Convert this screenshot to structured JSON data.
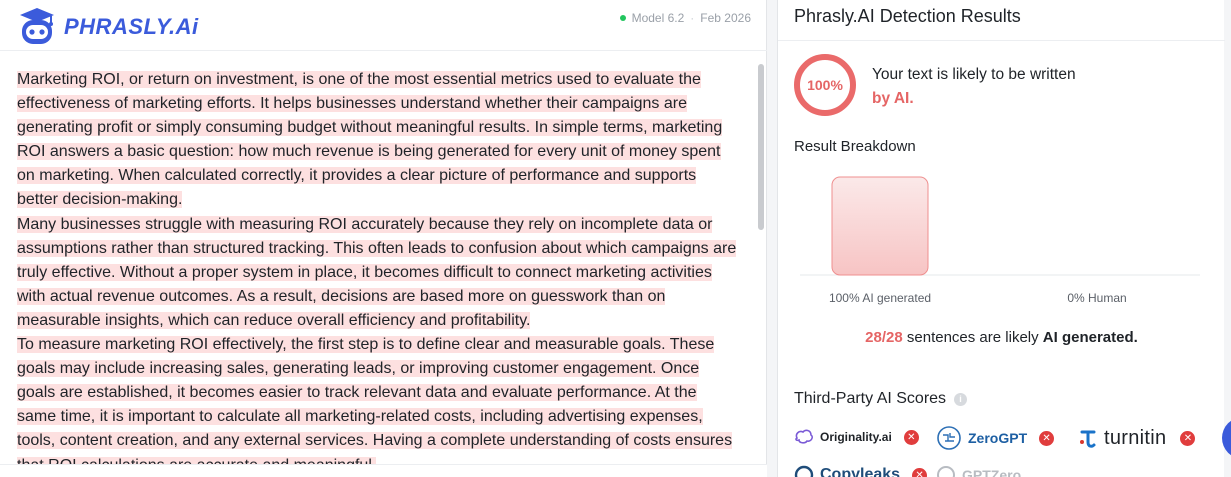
{
  "app": {
    "brand": "PHRASLY.Ai",
    "model": "Model 6.2",
    "date": "Feb 2026"
  },
  "document": {
    "sentences": [
      "Marketing ROI, or return on investment, is one of the most essential metrics used to evaluate the effectiveness of marketing efforts.",
      " It helps businesses understand whether their campaigns are generating profit or simply consuming budget without meaningful results.",
      " In simple terms, marketing ROI answers a basic question: how much revenue is being generated for every unit of money spent on marketing.",
      " When calculated correctly, it provides a clear picture of performance and supports better decision-making.",
      "Many businesses struggle with measuring ROI accurately because they rely on incomplete data or assumptions rather than structured tracking.",
      " This often leads to confusion about which campaigns are truly effective.",
      " Without a proper system in place, it becomes difficult to connect marketing activities with actual revenue outcomes.",
      " As a result, decisions are based more on guesswork than on measurable insights, which can reduce overall efficiency and profitability.",
      "To measure marketing ROI effectively, the first step is to define clear and measurable goals.",
      " These goals may include increasing sales, generating leads, or improving customer engagement.",
      " Once goals are established, it becomes easier to track relevant data and evaluate performance.",
      " At the same time, it is important to calculate all marketing-related costs, including advertising expenses, tools, content creation, and any external services.",
      " Having a complete understanding of costs ensures that ROI calculations are accurate and meaningful."
    ]
  },
  "results": {
    "title": "Phrasly.AI Detection Results",
    "percent": "100%",
    "verdict_line1": "Your text is likely to be written",
    "verdict_line2": "by AI.",
    "breakdown_title": "Result Breakdown",
    "summary_count": "28/28",
    "summary_text": " sentences are likely ",
    "summary_bold": "AI generated.",
    "third_party_title": "Third-Party AI Scores"
  },
  "chart_data": {
    "type": "bar",
    "categories": [
      "100% AI generated",
      "0% Human"
    ],
    "values": [
      100,
      0
    ],
    "ylim": [
      0,
      100
    ],
    "colors": [
      "#f7c9c9",
      "#e8eaee"
    ]
  },
  "third_party": [
    {
      "name": "Originality.ai",
      "icon": "brain-icon",
      "status": "x"
    },
    {
      "name": "ZeroGPT",
      "icon": "brain-circuit-icon",
      "status": "x"
    },
    {
      "name": "turnitin",
      "icon": "turnitin-mark-icon",
      "status": "x"
    },
    {
      "name": "Copyleaks",
      "icon": "copyleaks-icon",
      "status": "x"
    },
    {
      "name": "GPTZero",
      "icon": "gptzero-icon",
      "status": "x"
    }
  ],
  "colors": {
    "brand": "#3b5bdb",
    "ai": "#e56565",
    "highlight": "#fde0e0",
    "fail": "#e03d3d"
  }
}
